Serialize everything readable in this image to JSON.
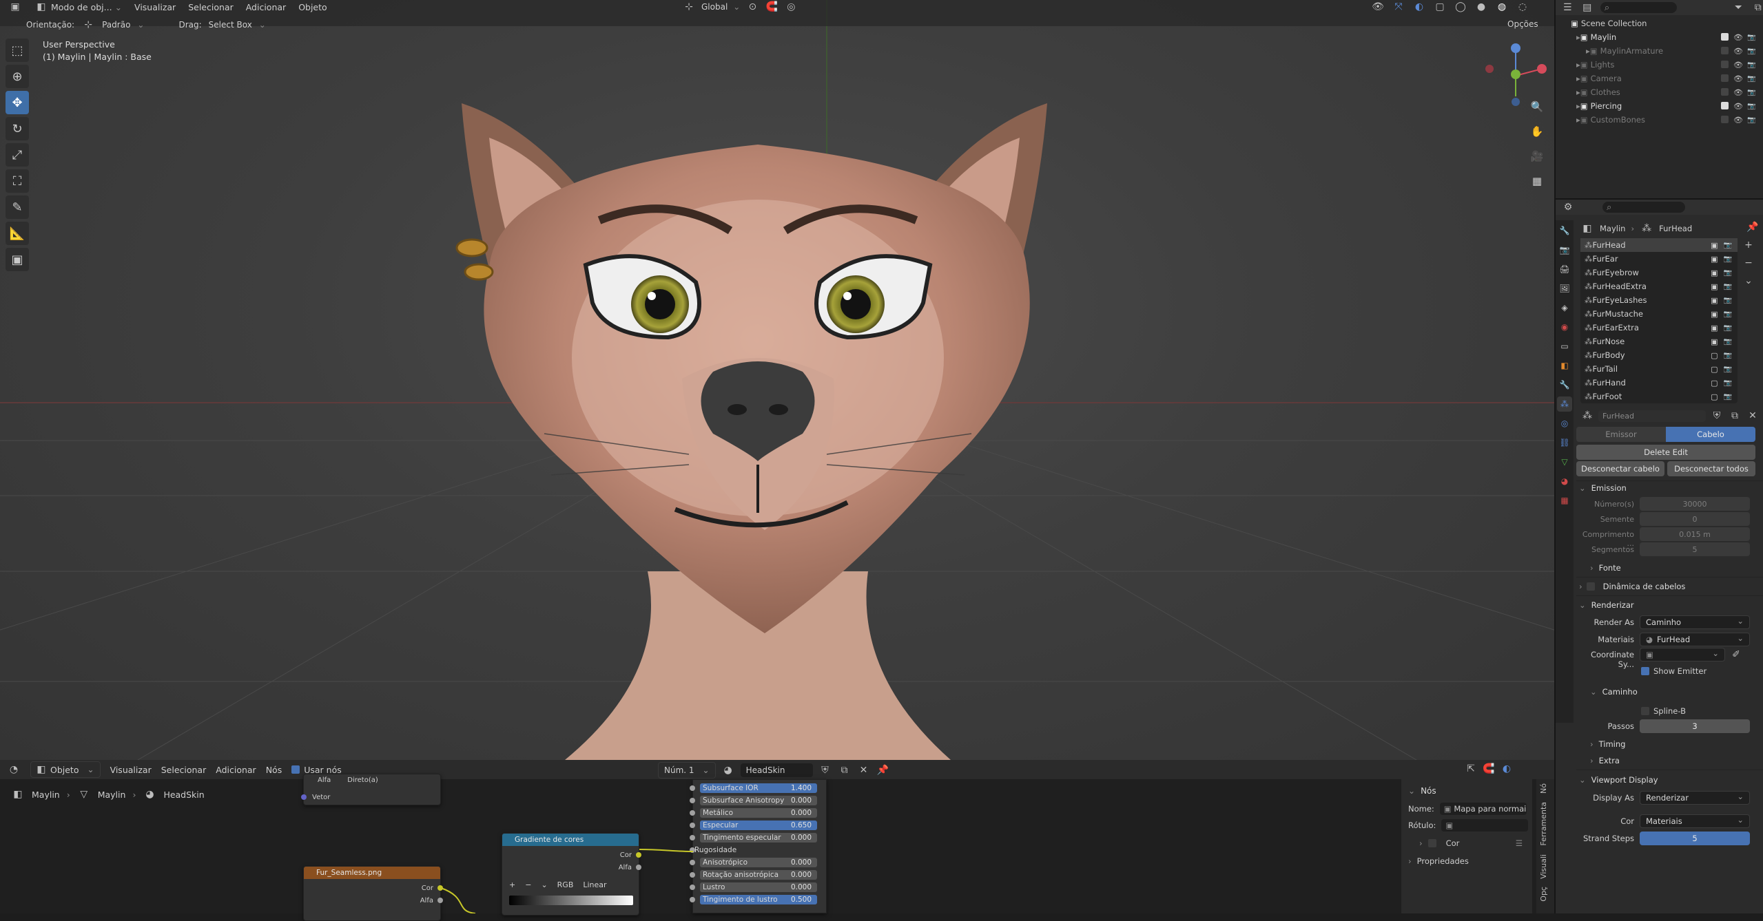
{
  "viewport": {
    "menu": {
      "mode": "Modo de obj...",
      "items": [
        "Visualizar",
        "Selecionar",
        "Adicionar",
        "Objeto"
      ]
    },
    "transform_orientation": "Global",
    "orientation_label": "Orientação:",
    "orientation_value": "Padrão",
    "drag_label": "Drag:",
    "drag_value": "Select Box",
    "options_label": "Opções",
    "perspective": "User Perspective",
    "object_info": "(1) Maylin | Maylin : Base"
  },
  "node_editor": {
    "mode": "Objeto",
    "menu": [
      "Visualizar",
      "Selecionar",
      "Adicionar",
      "Nós"
    ],
    "use_nodes_label": "Usar nós",
    "slot": "Núm. 1",
    "material": "HeadSkin",
    "breadcrumb": [
      "Maylin",
      "Maylin",
      "HeadSkin"
    ],
    "node_top_socket_1": "Alfa",
    "node_top_dropdown": "Direto(a)",
    "node_top_socket_2": "Vetor",
    "image_node_title": "Fur_Seamless.png",
    "image_node_outputs": [
      "Cor",
      "Alfa"
    ],
    "gradient_node_title": "Gradiente de cores",
    "gradient_node_outputs": [
      "Cor",
      "Alfa"
    ],
    "gradient_mode": "RGB",
    "gradient_interp": "Linear",
    "gradient_buttons": [
      "+",
      "−",
      "⌄"
    ],
    "bsdf_rows": [
      {
        "name": "Subsurface IOR",
        "value": "1.400",
        "hl": true
      },
      {
        "name": "Subsurface Anisotropy",
        "value": "0.000",
        "hl": false
      },
      {
        "name": "Metálico",
        "value": "0.000",
        "hl": false
      },
      {
        "name": "Especular",
        "value": "0.650",
        "hl": true
      },
      {
        "name": "Tingimento especular",
        "value": "0.000",
        "hl": false
      },
      {
        "name": "Rugosidade",
        "value": "",
        "hl": false
      },
      {
        "name": "Anisotrópico",
        "value": "0.000",
        "hl": false
      },
      {
        "name": "Rotação anisotrópica",
        "value": "0.000",
        "hl": false
      },
      {
        "name": "Lustro",
        "value": "0.000",
        "hl": false
      },
      {
        "name": "Tingimento de lustro",
        "value": "0.500",
        "hl": true
      }
    ],
    "side_panel": {
      "section": "Nós",
      "name_label": "Nome:",
      "name_value": "Mapa para normais",
      "label_label": "Rótulo:",
      "color_label": "Cor",
      "properties_label": "Propriedades"
    },
    "side_tabs": [
      "Nó",
      "Ferramenta",
      "Visuali",
      "Opç"
    ]
  },
  "outliner": {
    "root": "Scene Collection",
    "items": [
      {
        "name": "Maylin",
        "level": 1,
        "dim": false
      },
      {
        "name": "MaylinArmature",
        "level": 2,
        "dim": true
      },
      {
        "name": "Lights",
        "level": 1,
        "dim": true
      },
      {
        "name": "Camera",
        "level": 1,
        "dim": true
      },
      {
        "name": "Clothes",
        "level": 1,
        "dim": true
      },
      {
        "name": "Piercing",
        "level": 1,
        "dim": false
      },
      {
        "name": "CustomBones",
        "level": 1,
        "dim": true
      }
    ]
  },
  "properties": {
    "breadcrumb": [
      "Maylin",
      "FurHead"
    ],
    "particle_systems": [
      {
        "name": "FurHead",
        "sel": true,
        "vis": true
      },
      {
        "name": "FurEar",
        "sel": false,
        "vis": true
      },
      {
        "name": "FurEyebrow",
        "sel": false,
        "vis": true
      },
      {
        "name": "FurHeadExtra",
        "sel": false,
        "vis": true
      },
      {
        "name": "FurEyeLashes",
        "sel": false,
        "vis": true
      },
      {
        "name": "FurMustache",
        "sel": false,
        "vis": true
      },
      {
        "name": "FurEarExtra",
        "sel": false,
        "vis": true
      },
      {
        "name": "FurNose",
        "sel": false,
        "vis": true
      },
      {
        "name": "FurBody",
        "sel": false,
        "vis": false
      },
      {
        "name": "FurTail",
        "sel": false,
        "vis": false
      },
      {
        "name": "FurHand",
        "sel": false,
        "vis": false
      },
      {
        "name": "FurFoot",
        "sel": false,
        "vis": false
      }
    ],
    "settings_name": "FurHead",
    "type_tabs": [
      "Emissor",
      "Cabelo"
    ],
    "delete_edit": "Delete Edit",
    "disconnect": "Desconectar cabelo",
    "disconnect_all": "Desconectar todos",
    "emission": {
      "title": "Emission",
      "number_label": "Número(s)",
      "number": "30000",
      "seed_label": "Semente",
      "seed": "0",
      "length_label": "Comprimento ...",
      "length": "0.015 m",
      "segments_label": "Segmentos",
      "segments": "5"
    },
    "source_label": "Fonte",
    "hair_dynamics_label": "Dinâmica de cabelos",
    "render": {
      "title": "Renderizar",
      "render_as_label": "Render As",
      "render_as": "Caminho",
      "material_label": "Materiais",
      "material": "FurHead",
      "coord_label": "Coordinate Sy...",
      "show_emitter": "Show Emitter"
    },
    "path": {
      "title": "Caminho",
      "bspline": "Spline-B",
      "steps_label": "Passos",
      "steps": "3"
    },
    "timing_label": "Timing",
    "extra_label": "Extra",
    "viewport_display": {
      "title": "Viewport Display",
      "display_as_label": "Display As",
      "display_as": "Renderizar",
      "color_label": "Cor",
      "color": "Materiais",
      "strand_steps_label": "Strand Steps",
      "strand_steps": "5"
    }
  }
}
